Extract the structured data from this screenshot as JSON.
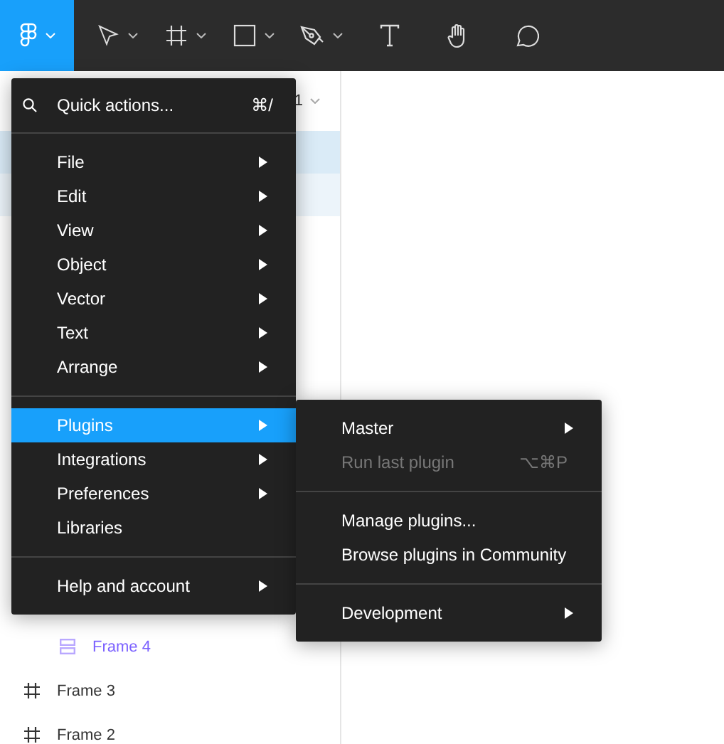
{
  "toolbar": {
    "tools": [
      {
        "kind": "logo",
        "has_menu": true,
        "selected": true
      },
      {
        "kind": "move",
        "has_menu": true,
        "selected": false
      },
      {
        "kind": "frame",
        "has_menu": true,
        "selected": false
      },
      {
        "kind": "rectangle",
        "has_menu": true,
        "selected": false
      },
      {
        "kind": "pen",
        "has_menu": true,
        "selected": false
      },
      {
        "kind": "text",
        "has_menu": false,
        "selected": false
      },
      {
        "kind": "hand",
        "has_menu": false,
        "selected": false
      },
      {
        "kind": "comment",
        "has_menu": false,
        "selected": false
      }
    ]
  },
  "layers_panel": {
    "page_selector": "1",
    "hidden_rows": [
      {
        "selected": true
      },
      {
        "selected": false
      }
    ],
    "layers": [
      {
        "name": "Frame 4",
        "kind": "autolayout",
        "nested": true
      },
      {
        "name": "Frame 3",
        "kind": "frame",
        "nested": false
      },
      {
        "name": "Frame 2",
        "kind": "frame",
        "nested": false
      }
    ]
  },
  "main_menu": {
    "items": [
      {
        "kind": "search",
        "label": "Quick actions...",
        "shortcut": "⌘/"
      },
      {
        "kind": "divider"
      },
      {
        "kind": "item",
        "label": "File",
        "submenu": true,
        "selected": false
      },
      {
        "kind": "item",
        "label": "Edit",
        "submenu": true,
        "selected": false
      },
      {
        "kind": "item",
        "label": "View",
        "submenu": true,
        "selected": false
      },
      {
        "kind": "item",
        "label": "Object",
        "submenu": true,
        "selected": false
      },
      {
        "kind": "item",
        "label": "Vector",
        "submenu": true,
        "selected": false
      },
      {
        "kind": "item",
        "label": "Text",
        "submenu": true,
        "selected": false
      },
      {
        "kind": "item",
        "label": "Arrange",
        "submenu": true,
        "selected": false
      },
      {
        "kind": "divider"
      },
      {
        "kind": "item",
        "label": "Plugins",
        "submenu": true,
        "selected": true
      },
      {
        "kind": "item",
        "label": "Integrations",
        "submenu": true,
        "selected": false
      },
      {
        "kind": "item",
        "label": "Preferences",
        "submenu": true,
        "selected": false
      },
      {
        "kind": "item",
        "label": "Libraries",
        "submenu": false,
        "selected": false
      },
      {
        "kind": "divider"
      },
      {
        "kind": "item",
        "label": "Help and account",
        "submenu": true,
        "selected": false
      }
    ]
  },
  "plugins_submenu": {
    "items": [
      {
        "kind": "item",
        "label": "Master",
        "submenu": true,
        "disabled": false
      },
      {
        "kind": "item",
        "label": "Run last plugin",
        "shortcut": "⌥⌘P",
        "submenu": false,
        "disabled": true
      },
      {
        "kind": "divider"
      },
      {
        "kind": "item",
        "label": "Manage plugins...",
        "submenu": false,
        "disabled": false
      },
      {
        "kind": "item",
        "label": "Browse plugins in Community",
        "submenu": false,
        "disabled": false
      },
      {
        "kind": "divider"
      },
      {
        "kind": "item",
        "label": "Development",
        "submenu": true,
        "disabled": false
      }
    ]
  }
}
